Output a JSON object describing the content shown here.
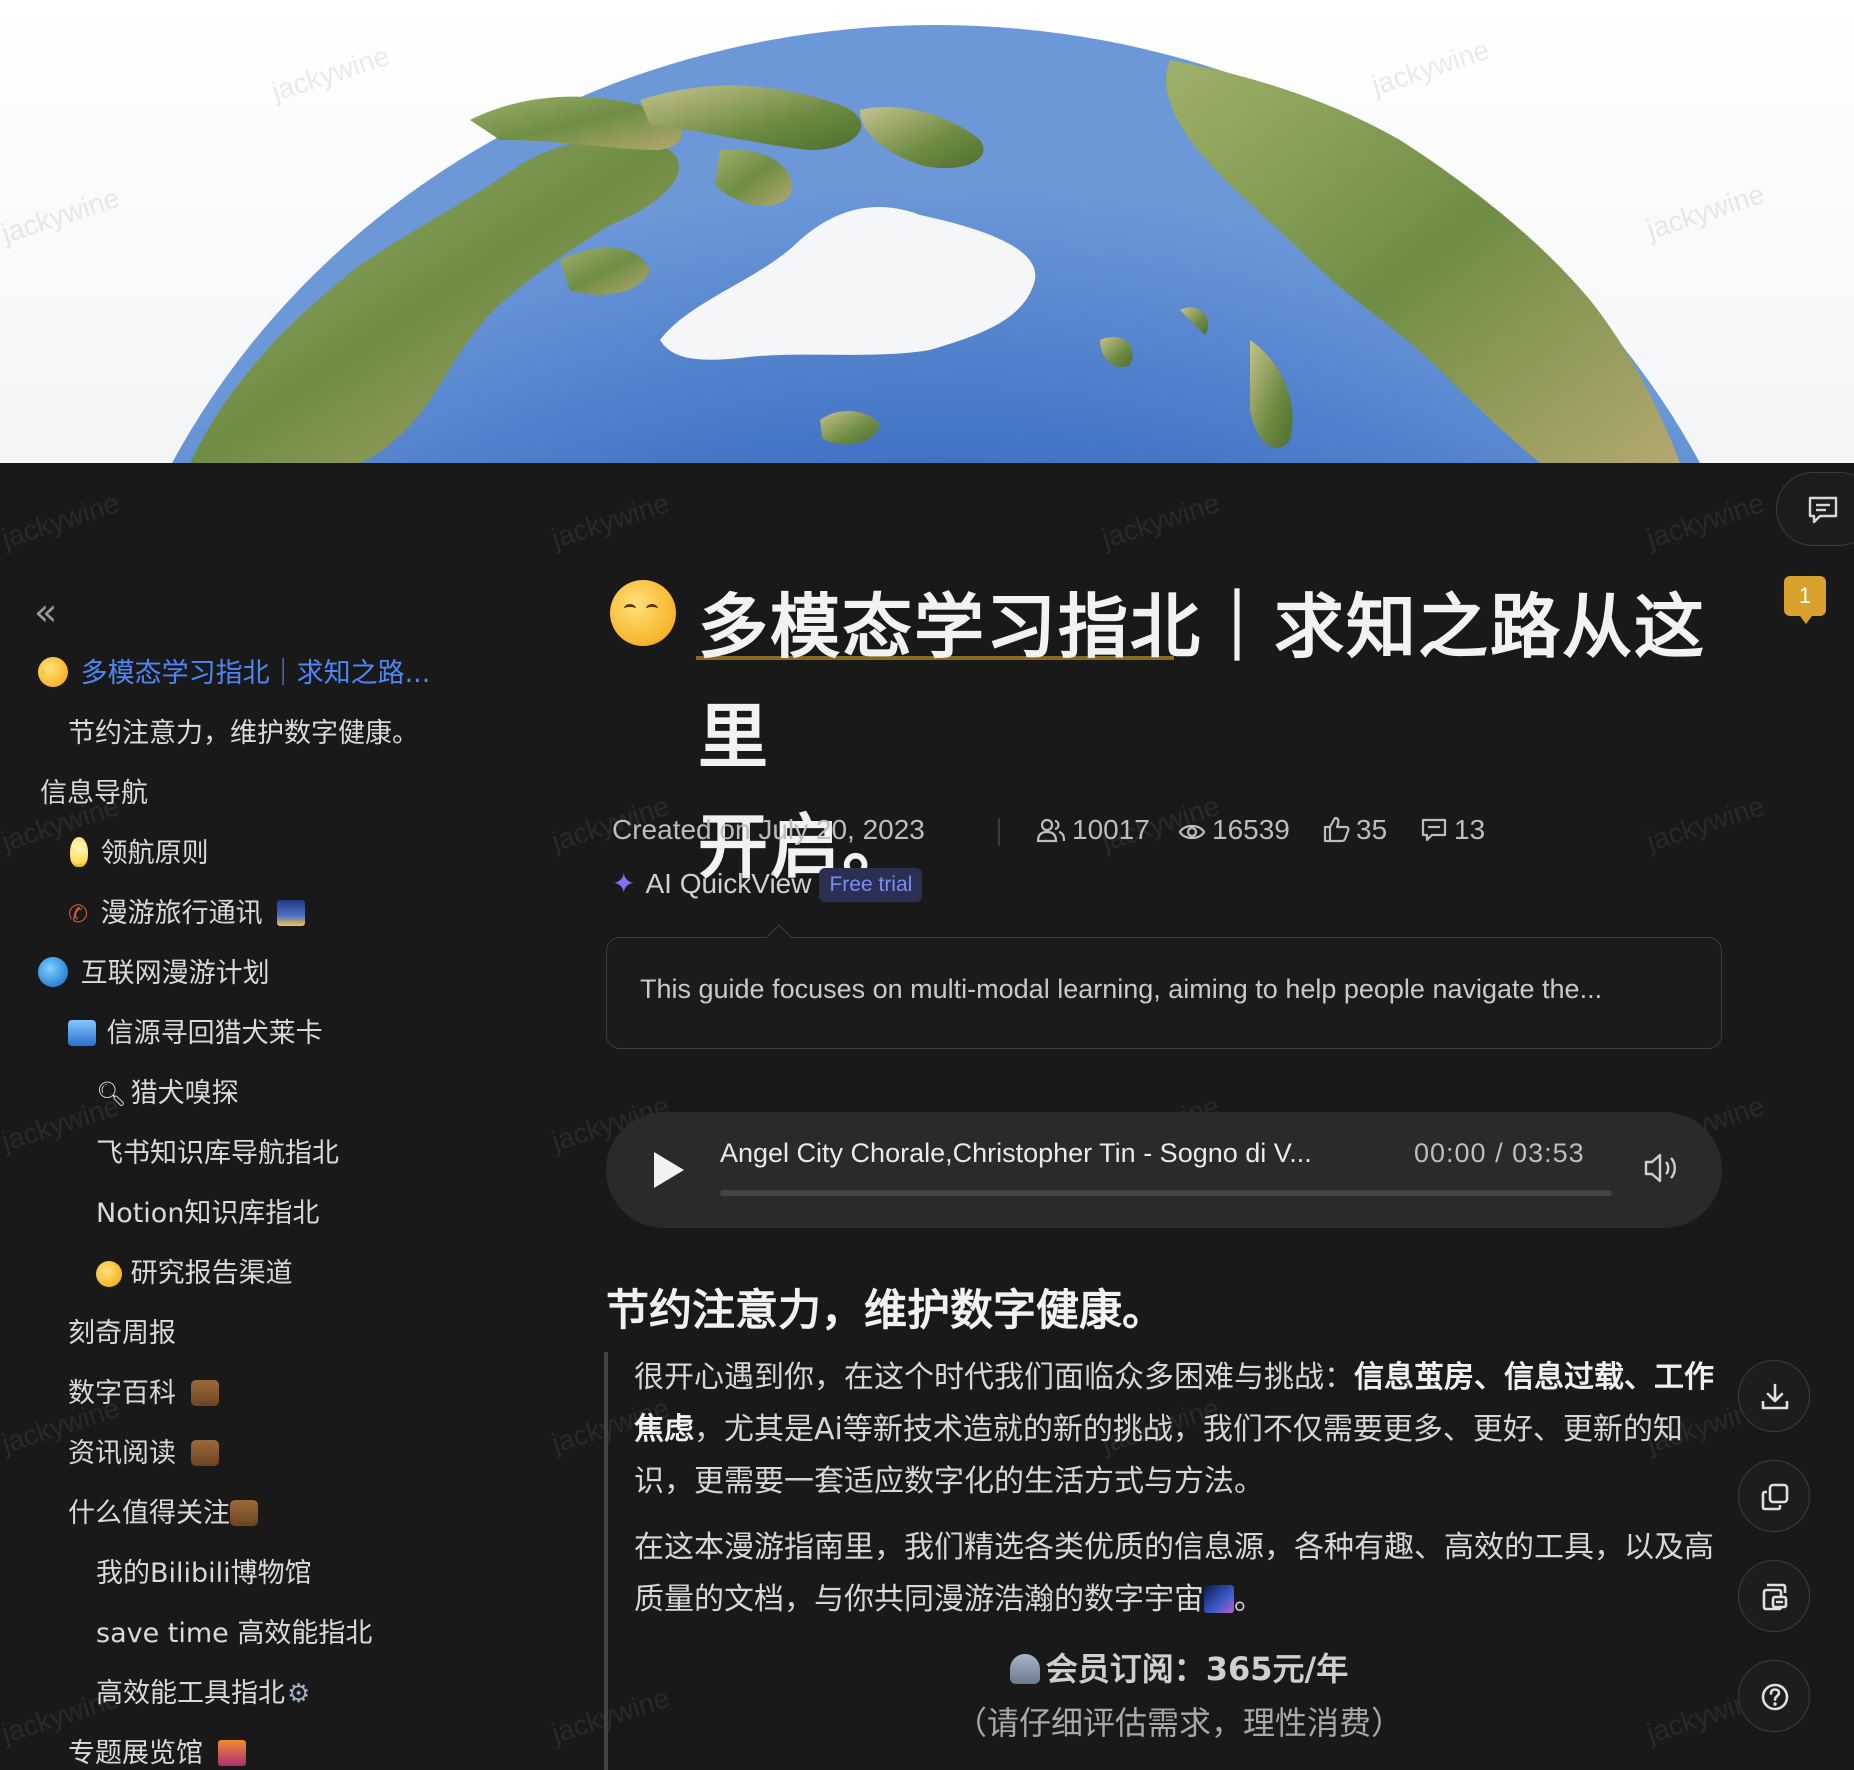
{
  "sidebar": {
    "collapse_label": "«",
    "items": [
      {
        "label": "多模态学习指北｜求知之路..."
      },
      {
        "label": "节约注意力，维护数字健康。"
      },
      {
        "label": "信息导航"
      },
      {
        "label": "领航原则"
      },
      {
        "label": "漫游旅行通讯"
      },
      {
        "label": "互联网漫游计划"
      },
      {
        "label": "信源寻回猎犬莱卡"
      },
      {
        "label": "猎犬嗅探"
      },
      {
        "label": "飞书知识库导航指北"
      },
      {
        "label": "Notion知识库指北"
      },
      {
        "label": "研究报告渠道"
      },
      {
        "label": "刻奇周报"
      },
      {
        "label": "数字百科"
      },
      {
        "label": "资讯阅读"
      },
      {
        "label": "什么值得关注"
      },
      {
        "label": "我的Bilibili博物馆"
      },
      {
        "label": "save time 高效能指北"
      },
      {
        "label": "高效能工具指北"
      },
      {
        "label": "专题展览馆"
      }
    ]
  },
  "doc": {
    "title_part1": "多模态学习指北",
    "title_part2": "｜求知之路从这里",
    "title_part3": "开启。",
    "created": "Created on July 20, 2023",
    "stats": {
      "visitors": "10017",
      "views": "16539",
      "likes": "35",
      "comments": "13"
    },
    "ai_quickview": "AI QuickView",
    "free_trial": "Free trial",
    "summary": "This guide focuses on multi-modal learning, aiming to help people navigate the..."
  },
  "audio": {
    "track": "Angel City Chorale,Christopher Tin - Sogno di V...",
    "time": "00:00 / 03:53",
    "progress": 0
  },
  "content": {
    "heading": "节约注意力，维护数字健康。",
    "p1_a": "很开心遇到你，在这个时代我们面临众多困难与挑战：",
    "p1_b1": "信息茧房",
    "p1_sep1": "、",
    "p1_b2": "信息过载",
    "p1_sep2": "、",
    "p1_b3": "工作焦虑",
    "p1_c": "，尤其是Ai等新技术造就的新的挑战，我们不仅需要更多、更好、更新的知识，更需要一套适应数字化的生活方式与方法。",
    "p2_a": "在这本漫游指南里，我们精选各类优质的信息源，各种有趣、高效的工具，以及高质量的文档，与你共同漫游浩瀚的数字宇宙",
    "p2_end": "。",
    "member": "会员订阅：365元/年",
    "note": "（请仔细评估需求，理性消费）"
  },
  "comments": {
    "badge": "1"
  },
  "watermark": "jackywine",
  "icons": [
    "comment-icon",
    "download-icon",
    "copy-icon",
    "template-icon",
    "help-icon",
    "play-icon",
    "volume-icon",
    "sparkle-icon",
    "users-icon",
    "eye-icon",
    "thumbs-up-icon",
    "message-icon"
  ]
}
